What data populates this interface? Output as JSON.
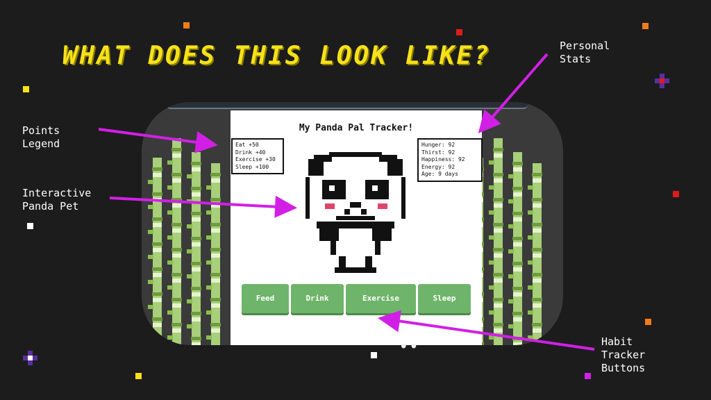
{
  "slide": {
    "title": "WHAT DOES THIS LOOK LIKE?",
    "annotations": {
      "personal_stats": "Personal\nStats",
      "points_legend": "Points\nLegend",
      "interactive_pet": "Interactive\nPanda Pet",
      "habit_buttons": "Habit\nTracker\nButtons"
    },
    "annotation_color": "#d21fe6"
  },
  "app": {
    "title": "My Panda Pal Tracker!",
    "legend": [
      "Eat +50",
      "Drink +40",
      "Exercise +30",
      "Sleep +100"
    ],
    "stats": [
      "Hunger: 92",
      "Thirst: 92",
      "Happiness: 92",
      "Energy: 92",
      "Age: 9 days"
    ],
    "buttons": [
      "Feed",
      "Drink",
      "Exercise",
      "Sleep"
    ],
    "button_color": "#6fb46b",
    "pet_icon": "panda-pixel-icon"
  },
  "colors": {
    "background": "#1c1c1c",
    "title": "#f6e21a",
    "bamboo": "#a8cf7a"
  }
}
